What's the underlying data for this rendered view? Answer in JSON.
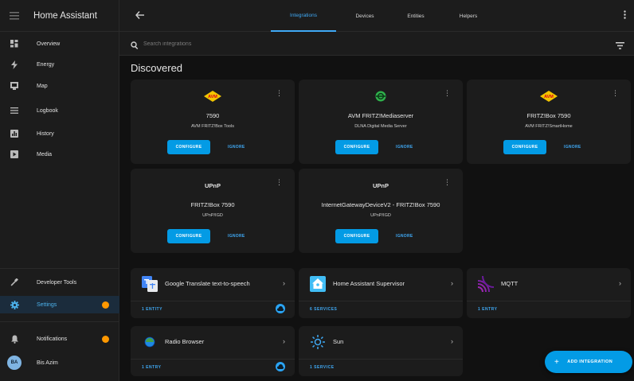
{
  "app": {
    "title": "Home Assistant"
  },
  "sidebar": {
    "items": [
      {
        "label": "Overview",
        "icon": "view-dashboard-icon"
      },
      {
        "label": "Energy",
        "icon": "lightning-bolt-icon"
      },
      {
        "label": "Map",
        "icon": "map-icon"
      },
      {
        "label": "Logbook",
        "icon": "logbook-icon"
      },
      {
        "label": "History",
        "icon": "chart-box-icon"
      },
      {
        "label": "Media",
        "icon": "play-box-icon"
      }
    ],
    "developer_tools": "Developer Tools",
    "settings": "Settings",
    "notifications": "Notifications",
    "user": {
      "initials": "BA",
      "name": "Bis Azim"
    }
  },
  "topbar": {
    "tabs": [
      {
        "label": "Integrations",
        "active": true
      },
      {
        "label": "Devices",
        "active": false
      },
      {
        "label": "Entities",
        "active": false
      },
      {
        "label": "Helpers",
        "active": false
      }
    ]
  },
  "search": {
    "placeholder": "Search integrations"
  },
  "discovered": {
    "title": "Discovered",
    "configure_label": "CONFIGURE",
    "ignore_label": "IGNORE",
    "cards": [
      {
        "logo": "avm",
        "title": "7590",
        "subtitle": "AVM FRITZ!Box Tools"
      },
      {
        "logo": "dlna",
        "title": "AVM FRITZ!Mediaserver",
        "subtitle": "DLNA Digital Media Server"
      },
      {
        "logo": "avm",
        "title": "FRITZ!Box 7590",
        "subtitle": "AVM FRITZ!SmartHome"
      },
      {
        "logo": "upnp",
        "title": "FRITZ!Box 7590",
        "subtitle": "UPnP/IGD"
      },
      {
        "logo": "upnp",
        "title": "InternetGatewayDeviceV2 - FRITZ!Box 7590",
        "subtitle": "UPnP/IGD"
      }
    ],
    "logo_texts": {
      "avm": "AVM",
      "upnp": "UPnP"
    }
  },
  "integrations": [
    {
      "name": "Google Translate text-to-speech",
      "count": "1 ENTITY",
      "cloud": true
    },
    {
      "name": "Home Assistant Supervisor",
      "count": "6 SERVICES",
      "cloud": false
    },
    {
      "name": "MQTT",
      "count": "1 ENTRY",
      "cloud": false
    },
    {
      "name": "Radio Browser",
      "count": "1 ENTRY",
      "cloud": true
    },
    {
      "name": "Sun",
      "count": "1 SERVICE",
      "cloud": false
    }
  ],
  "fab": {
    "label": "ADD INTEGRATION"
  },
  "colors": {
    "accent": "#039be5",
    "sidebar_bg": "#1c1c1c",
    "page_bg": "#111111",
    "notification_dot": "#ff9800"
  }
}
